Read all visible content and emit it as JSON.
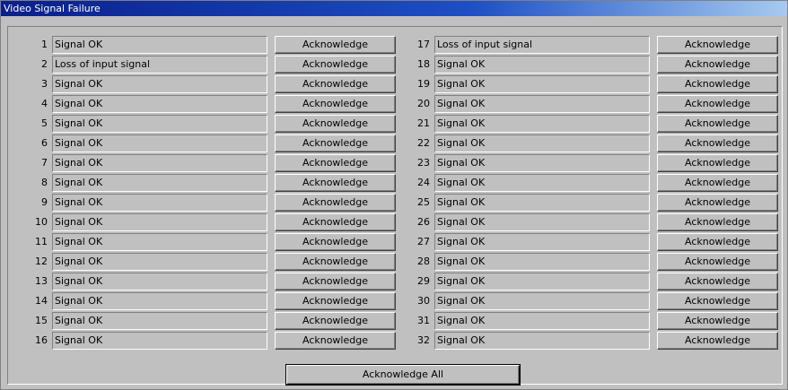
{
  "window": {
    "title": "Video Signal Failure"
  },
  "channels_left": [
    {
      "number": "1",
      "status": "Signal OK",
      "button": "Acknowledge"
    },
    {
      "number": "2",
      "status": "Loss of input signal",
      "button": "Acknowledge"
    },
    {
      "number": "3",
      "status": "Signal OK",
      "button": "Acknowledge"
    },
    {
      "number": "4",
      "status": "Signal OK",
      "button": "Acknowledge"
    },
    {
      "number": "5",
      "status": "Signal OK",
      "button": "Acknowledge"
    },
    {
      "number": "6",
      "status": "Signal OK",
      "button": "Acknowledge"
    },
    {
      "number": "7",
      "status": "Signal OK",
      "button": "Acknowledge"
    },
    {
      "number": "8",
      "status": "Signal OK",
      "button": "Acknowledge"
    },
    {
      "number": "9",
      "status": "Signal OK",
      "button": "Acknowledge"
    },
    {
      "number": "10",
      "status": "Signal OK",
      "button": "Acknowledge"
    },
    {
      "number": "11",
      "status": "Signal OK",
      "button": "Acknowledge"
    },
    {
      "number": "12",
      "status": "Signal OK",
      "button": "Acknowledge"
    },
    {
      "number": "13",
      "status": "Signal OK",
      "button": "Acknowledge"
    },
    {
      "number": "14",
      "status": "Signal OK",
      "button": "Acknowledge"
    },
    {
      "number": "15",
      "status": "Signal OK",
      "button": "Acknowledge"
    },
    {
      "number": "16",
      "status": "Signal OK",
      "button": "Acknowledge"
    }
  ],
  "channels_right": [
    {
      "number": "17",
      "status": "Loss of input signal",
      "button": "Acknowledge"
    },
    {
      "number": "18",
      "status": "Signal OK",
      "button": "Acknowledge"
    },
    {
      "number": "19",
      "status": "Signal OK",
      "button": "Acknowledge"
    },
    {
      "number": "20",
      "status": "Signal OK",
      "button": "Acknowledge"
    },
    {
      "number": "21",
      "status": "Signal OK",
      "button": "Acknowledge"
    },
    {
      "number": "22",
      "status": "Signal OK",
      "button": "Acknowledge"
    },
    {
      "number": "23",
      "status": "Signal OK",
      "button": "Acknowledge"
    },
    {
      "number": "24",
      "status": "Signal OK",
      "button": "Acknowledge"
    },
    {
      "number": "25",
      "status": "Signal OK",
      "button": "Acknowledge"
    },
    {
      "number": "26",
      "status": "Signal OK",
      "button": "Acknowledge"
    },
    {
      "number": "27",
      "status": "Signal OK",
      "button": "Acknowledge"
    },
    {
      "number": "28",
      "status": "Signal OK",
      "button": "Acknowledge"
    },
    {
      "number": "29",
      "status": "Signal OK",
      "button": "Acknowledge"
    },
    {
      "number": "30",
      "status": "Signal OK",
      "button": "Acknowledge"
    },
    {
      "number": "31",
      "status": "Signal OK",
      "button": "Acknowledge"
    },
    {
      "number": "32",
      "status": "Signal OK",
      "button": "Acknowledge"
    }
  ],
  "footer": {
    "acknowledge_all_label": "Acknowledge All"
  },
  "colors": {
    "titlebar_start": "#0a1f8a",
    "titlebar_end": "#a6caf0",
    "window_face": "#c0c0c0"
  }
}
